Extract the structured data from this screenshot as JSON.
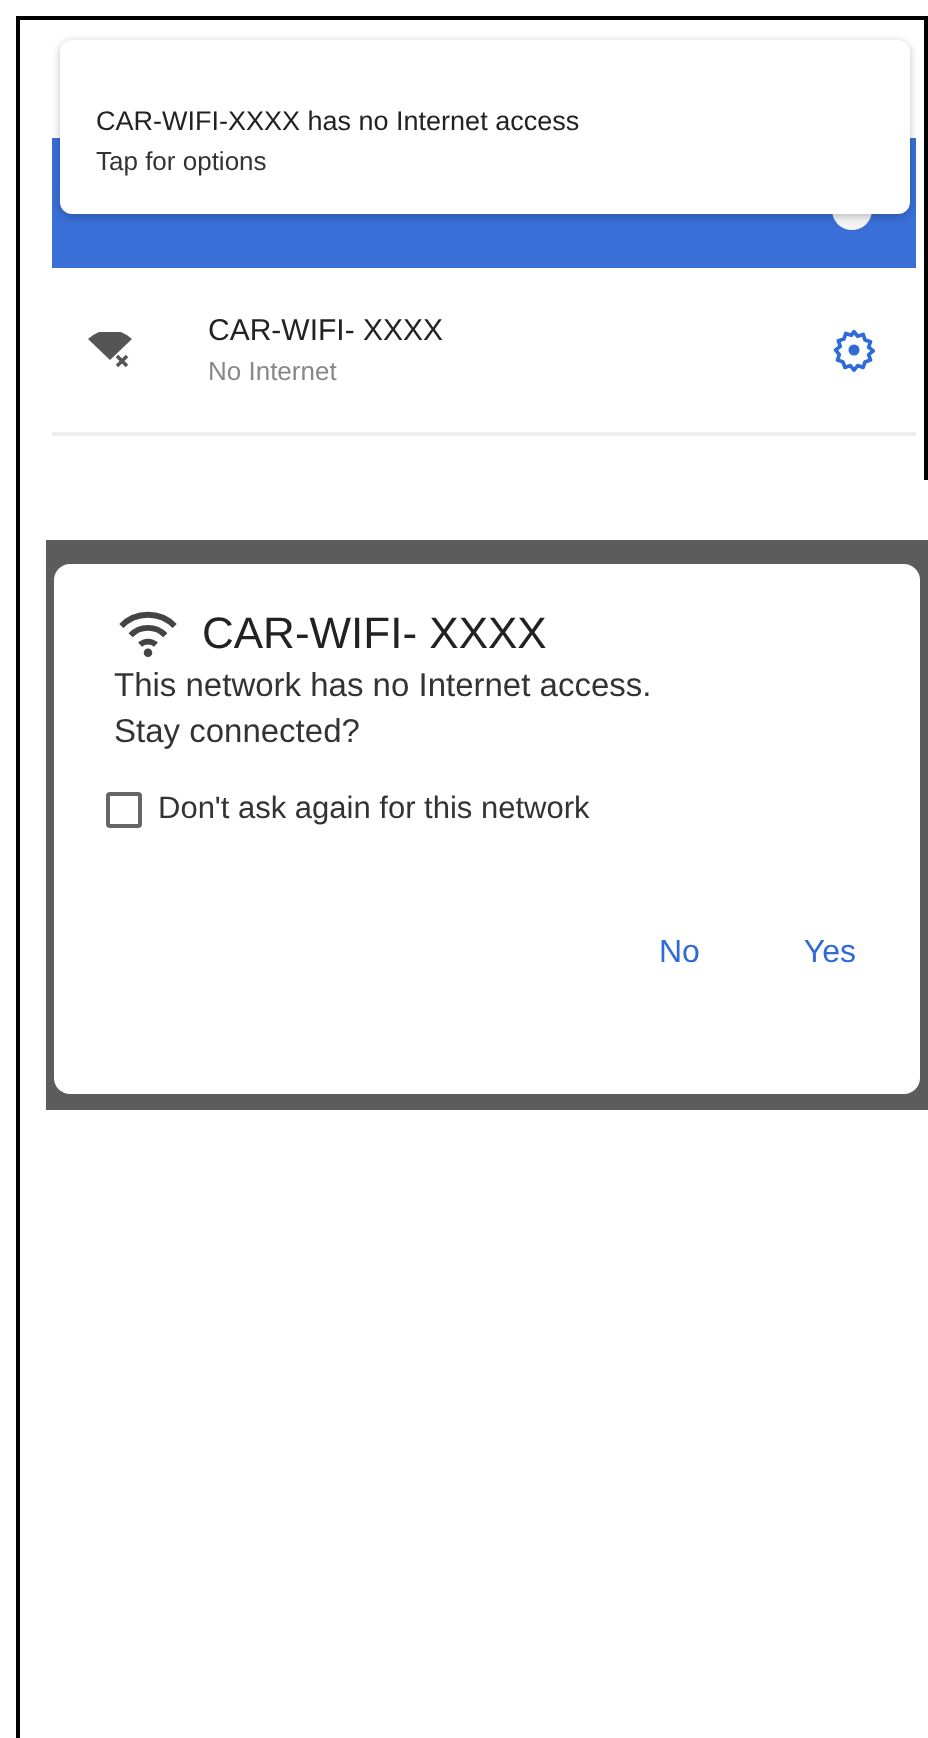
{
  "notification": {
    "title": "CAR-WIFI-XXXX has no Internet access",
    "subtitle": "Tap for options"
  },
  "wifi_toggle": {
    "on": true
  },
  "network": {
    "name": "CAR-WIFI- XXXX",
    "status": "No Internet"
  },
  "dialog": {
    "title": "CAR-WIFI- XXXX",
    "message": "This network has no Internet access.",
    "question": "Stay connected?",
    "checkbox": {
      "label": "Don't ask again for this network",
      "checked": false
    },
    "buttons": [
      "No",
      "Yes"
    ]
  }
}
